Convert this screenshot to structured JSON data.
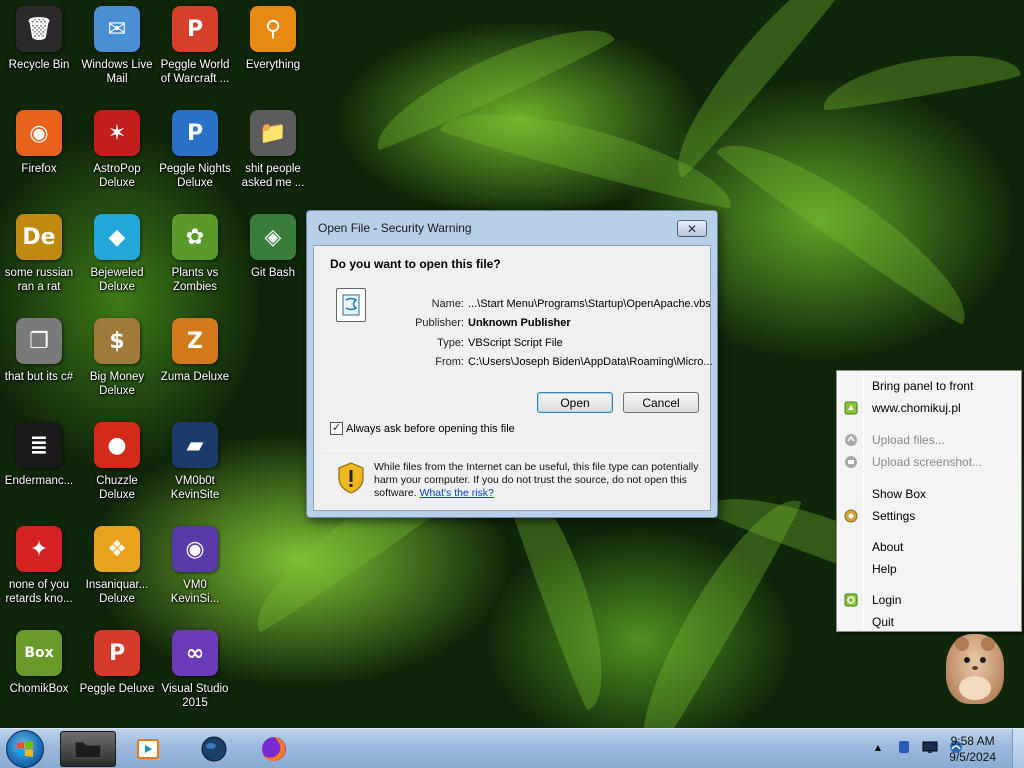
{
  "desktop": {
    "icons": [
      {
        "label": "Recycle Bin",
        "glyph": "🗑",
        "color": "#2a2a2a",
        "icon": "recycle-bin-icon"
      },
      {
        "label": "Windows Live\nMail",
        "glyph": "✉",
        "color": "#4a8fd4",
        "icon": "mail-icon"
      },
      {
        "label": "Peggle World\nof Warcraft ...",
        "glyph": "P",
        "color": "#d6402a",
        "icon": "peggle-wow-icon"
      },
      {
        "label": "Everything",
        "glyph": "⚲",
        "color": "#e88a12",
        "icon": "everything-search-icon"
      },
      {
        "label": "Firefox",
        "glyph": "◉",
        "color": "#e8621c",
        "icon": "firefox-icon"
      },
      {
        "label": "AstroPop\nDeluxe",
        "glyph": "✶",
        "color": "#c21e1e",
        "icon": "astropop-icon"
      },
      {
        "label": "Peggle Nights\nDeluxe",
        "glyph": "P",
        "color": "#2a72c8",
        "icon": "peggle-nights-icon"
      },
      {
        "label": "shit people\nasked me ...",
        "glyph": "📁",
        "color": "#5c5c5c",
        "icon": "folder-icon"
      },
      {
        "label": "some russian\nran a rat",
        "glyph": "De",
        "color": "#c08a10",
        "icon": "de-app-icon"
      },
      {
        "label": "Bejeweled\nDeluxe",
        "glyph": "◆",
        "color": "#22a8d8",
        "icon": "bejeweled-icon"
      },
      {
        "label": "Plants vs\nZombies",
        "glyph": "✿",
        "color": "#5a9a2a",
        "icon": "plants-vs-zombies-icon"
      },
      {
        "label": "Git Bash",
        "glyph": "◈",
        "color": "#3a7d3a",
        "icon": "git-bash-icon"
      },
      {
        "label": "that but its c#",
        "glyph": "❐",
        "color": "#7a7a7a",
        "icon": "windows-stack-icon"
      },
      {
        "label": "Big Money\nDeluxe",
        "glyph": "$",
        "color": "#a07a3a",
        "icon": "big-money-icon"
      },
      {
        "label": "Zuma Deluxe",
        "glyph": "Z",
        "color": "#d4781c",
        "icon": "zuma-icon"
      },
      {
        "label": "",
        "glyph": "",
        "color": "",
        "icon": ""
      },
      {
        "label": "Endermanc...",
        "glyph": "≣",
        "color": "#1a1a1a",
        "icon": "terminal-icon"
      },
      {
        "label": "Chuzzle\nDeluxe",
        "glyph": "●",
        "color": "#d42a1a",
        "icon": "chuzzle-icon"
      },
      {
        "label": "VM0b0t\nKevinSite",
        "glyph": "▰",
        "color": "#1c3a6a",
        "icon": "vm-site-icon"
      },
      {
        "label": "",
        "glyph": "",
        "color": "",
        "icon": ""
      },
      {
        "label": "none of you\nretards kno...",
        "glyph": "✦",
        "color": "#d42222",
        "icon": "red-dino-icon"
      },
      {
        "label": "Insaniquar...\nDeluxe",
        "glyph": "❖",
        "color": "#e8a21c",
        "icon": "insaniquarium-icon"
      },
      {
        "label": "VM0\nKevinSi...",
        "glyph": "◉",
        "color": "#5a3aa8",
        "icon": "firefox-file-icon"
      },
      {
        "label": "",
        "glyph": "",
        "color": "",
        "icon": ""
      },
      {
        "label": "ChomikBox",
        "glyph": "Box",
        "color": "#6a9a2a",
        "icon": "chomikbox-icon"
      },
      {
        "label": "Peggle Deluxe",
        "glyph": "P",
        "color": "#d63a2a",
        "icon": "peggle-deluxe-icon"
      },
      {
        "label": "Visual Studio\n2015",
        "glyph": "∞",
        "color": "#6a3ab8",
        "icon": "visual-studio-icon"
      }
    ]
  },
  "dialog": {
    "title": "Open File - Security Warning",
    "close_glyph": "✕",
    "question": "Do you want to open this file?",
    "fields": {
      "name_key": "Name:",
      "name_val": "...\\Start Menu\\Programs\\Startup\\OpenApache.vbs",
      "publisher_key": "Publisher:",
      "publisher_val": "Unknown Publisher",
      "type_key": "Type:",
      "type_val": "VBScript Script File",
      "from_key": "From:",
      "from_val": "C:\\Users\\Joseph Biden\\AppData\\Roaming\\Micro..."
    },
    "open_label": "Open",
    "cancel_label": "Cancel",
    "checkbox_label": "Always ask before opening this file",
    "checkbox_checked": true,
    "warning_text": "While files from the Internet can be useful, this file type can potentially harm your computer. If you do not trust the source, do not open this software. ",
    "warning_link": "What's the risk?"
  },
  "menu": {
    "items": [
      {
        "label": "Bring panel to front",
        "enabled": true,
        "icon": ""
      },
      {
        "label": "www.chomikuj.pl",
        "enabled": true,
        "icon": "chomik-home-icon"
      },
      {
        "label": "Upload files...",
        "enabled": false,
        "icon": "upload-files-icon"
      },
      {
        "label": "Upload screenshot...",
        "enabled": false,
        "icon": "upload-screenshot-icon"
      },
      {
        "label": "Show Box",
        "enabled": true,
        "icon": ""
      },
      {
        "label": "Settings",
        "enabled": true,
        "icon": "settings-gear-icon"
      },
      {
        "label": "About",
        "enabled": true,
        "icon": ""
      },
      {
        "label": "Help",
        "enabled": true,
        "icon": ""
      },
      {
        "label": "Login",
        "enabled": true,
        "icon": "login-icon"
      },
      {
        "label": "Quit",
        "enabled": true,
        "icon": ""
      }
    ]
  },
  "taskbar": {
    "time": "9:58 AM",
    "date": "9/5/2024",
    "tray_arrow": "▲"
  }
}
